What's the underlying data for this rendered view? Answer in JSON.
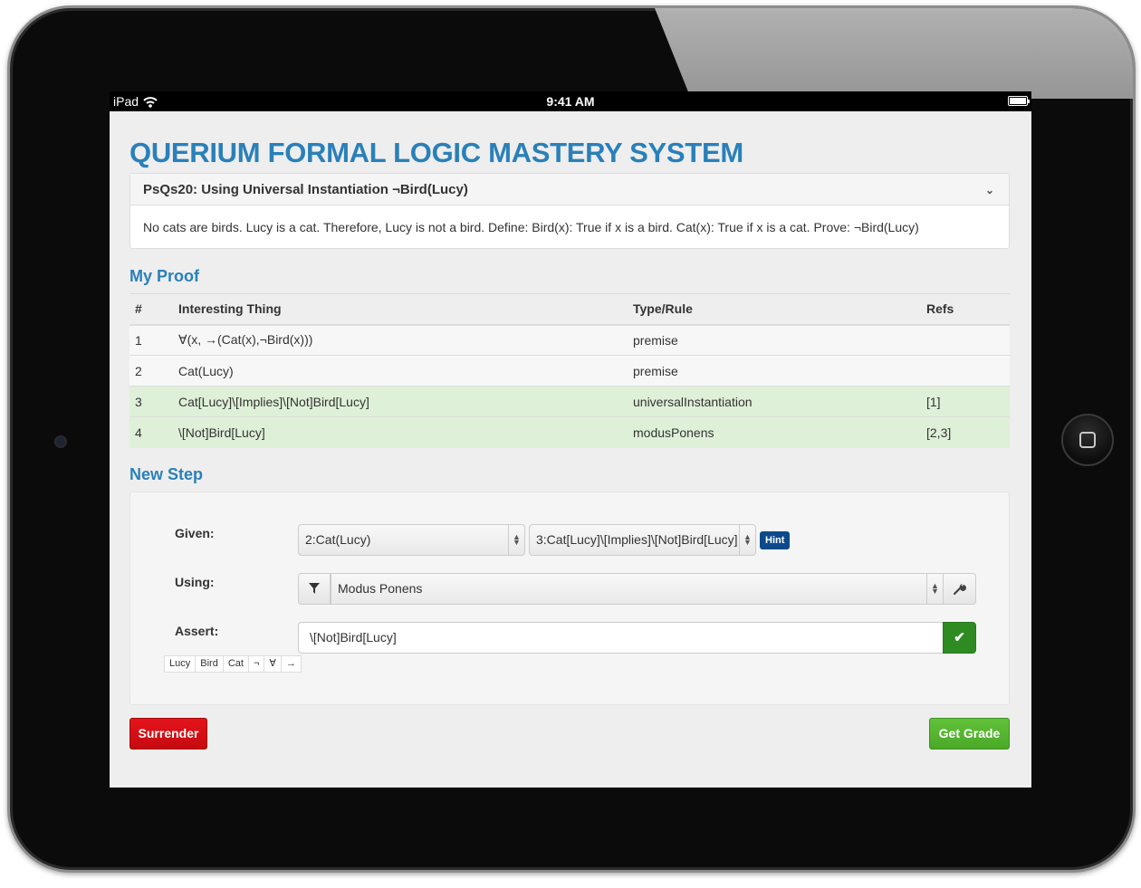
{
  "status_bar": {
    "device": "iPad",
    "time": "9:41 AM"
  },
  "app": {
    "title": "QUERIUM FORMAL LOGIC MASTERY SYSTEM"
  },
  "problem": {
    "heading": "PsQs20: Using Universal Instantiation ¬Bird(Lucy)",
    "text": "No cats are birds. Lucy is a cat. Therefore, Lucy is not a bird. Define: Bird(x): True if x is a bird. Cat(x): True if x is a cat. Prove: ¬Bird(Lucy)"
  },
  "proof": {
    "title": "My Proof",
    "columns": [
      "#",
      "Interesting Thing",
      "Type/Rule",
      "Refs"
    ],
    "rows": [
      {
        "num": "1",
        "thing": "∀(x, →(Cat(x),¬Bird(x)))",
        "rule": "premise",
        "refs": ""
      },
      {
        "num": "2",
        "thing": "Cat(Lucy)",
        "rule": "premise",
        "refs": ""
      },
      {
        "num": "3",
        "thing": "Cat[Lucy]\\[Implies]\\[Not]Bird[Lucy]",
        "rule": "universalInstantiation",
        "refs": "[1]"
      },
      {
        "num": "4",
        "thing": "\\[Not]Bird[Lucy]",
        "rule": "modusPonens",
        "refs": "[2,3]"
      }
    ]
  },
  "new_step": {
    "title": "New Step",
    "given_label": "Given:",
    "given_1": "2:Cat(Lucy)",
    "given_2": "3:Cat[Lucy]\\[Implies]\\[Not]Bird[Lucy]",
    "hint_label": "Hint",
    "using_label": "Using:",
    "using_value": "Modus Ponens",
    "assert_label": "Assert:",
    "assert_value": "\\[Not]Bird[Lucy]",
    "symbols": [
      "Lucy",
      "Bird",
      "Cat",
      "¬",
      "∀",
      "→"
    ]
  },
  "actions": {
    "surrender": "Surrender",
    "get_grade": "Get Grade"
  },
  "colors": {
    "title_blue": "#2a80b9",
    "valid_row": "#dff0d8",
    "surrender_red": "#d8101a",
    "grade_green": "#56b531",
    "hint_navy": "#0d4a8c"
  }
}
